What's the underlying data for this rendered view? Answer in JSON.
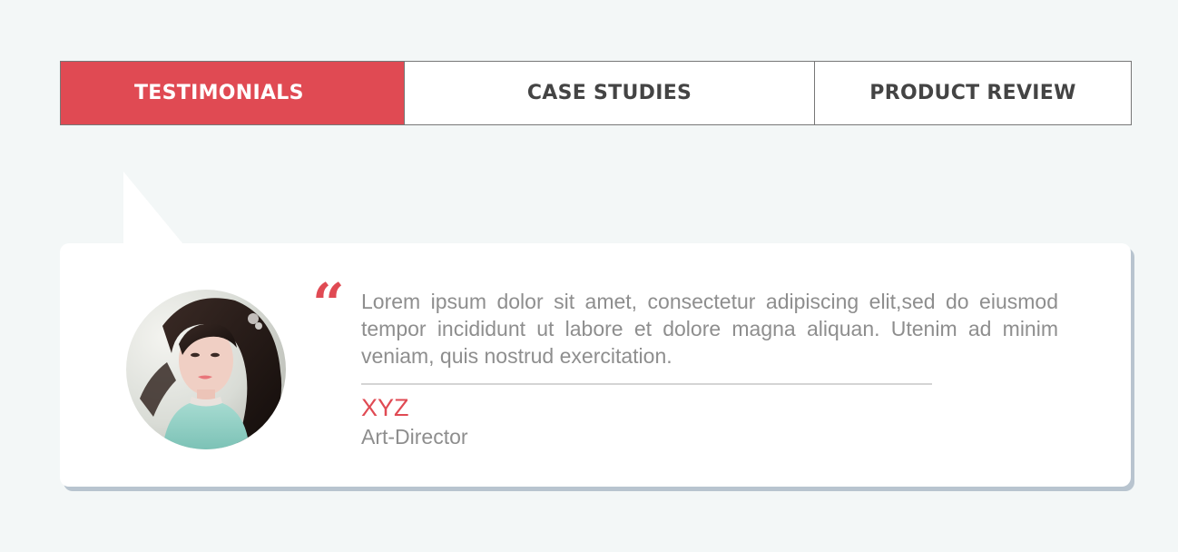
{
  "tabs": [
    {
      "label": "TESTIMONIALS",
      "active": true
    },
    {
      "label": "CASE STUDIES",
      "active": false
    },
    {
      "label": "PRODUCT REVIEW",
      "active": false
    }
  ],
  "testimonial": {
    "quote_icon": "quote-icon",
    "quote_glyph": "“",
    "text": "Lorem ipsum dolor sit amet, consectetur adipiscing elit,sed do eiusmod tempor incididunt ut labore et dolore magna aliquan. Utenim ad minim veniam, quis nostrud exercitation.",
    "author_name": "XYZ",
    "author_role": "Art-Director"
  },
  "colors": {
    "accent": "#e04a53",
    "background": "#f3f7f7",
    "text_muted": "#8e8e8e",
    "tab_text": "#444444",
    "card_shadow": "#b8c4cf"
  }
}
